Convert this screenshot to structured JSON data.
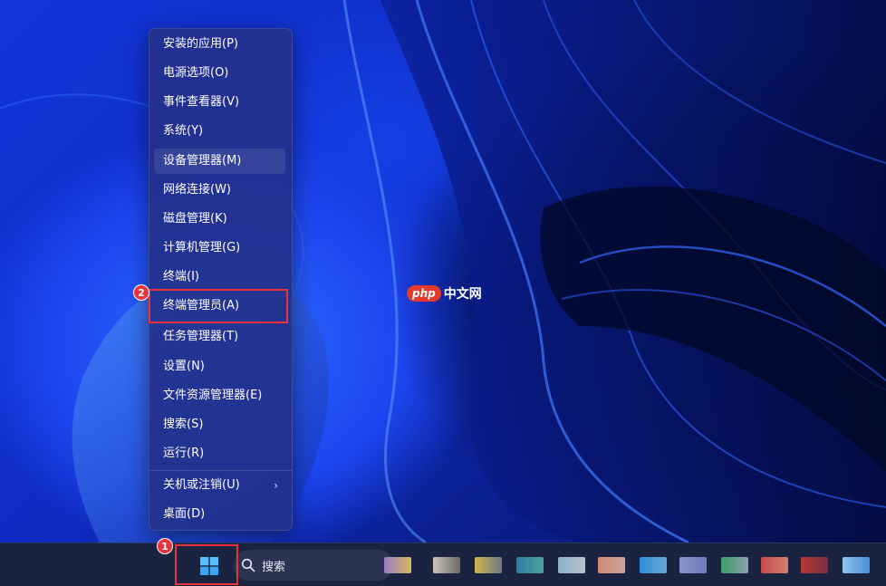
{
  "watermark": {
    "brand": "php",
    "text": "中文网"
  },
  "context_menu": {
    "items": [
      {
        "label": "安装的应用(P)"
      },
      {
        "label": "电源选项(O)"
      },
      {
        "label": "事件查看器(V)"
      },
      {
        "label": "系统(Y)"
      },
      {
        "label": "设备管理器(M)"
      },
      {
        "label": "网络连接(W)"
      },
      {
        "label": "磁盘管理(K)"
      },
      {
        "label": "计算机管理(G)"
      },
      {
        "label": "终端(I)"
      },
      {
        "label": "终端管理员(A)"
      },
      {
        "label": "任务管理器(T)"
      },
      {
        "label": "设置(N)"
      },
      {
        "label": "文件资源管理器(E)"
      },
      {
        "label": "搜索(S)"
      },
      {
        "label": "运行(R)"
      },
      {
        "label": "关机或注销(U)",
        "has_submenu": true
      },
      {
        "label": "桌面(D)"
      }
    ],
    "hovered_item": "设备管理器(M)"
  },
  "annotations": [
    {
      "number": "1",
      "target": "start-button"
    },
    {
      "number": "2",
      "target": "menu-item-terminal-admin"
    }
  ],
  "taskbar": {
    "search_label": "搜索",
    "icons": [
      "start-icon",
      "search-icon",
      "pinned-app-icons"
    ]
  },
  "colors": {
    "highlight_red": "#e8323c",
    "menu_background": "#22308c",
    "taskbar_background": "#1a2440"
  }
}
